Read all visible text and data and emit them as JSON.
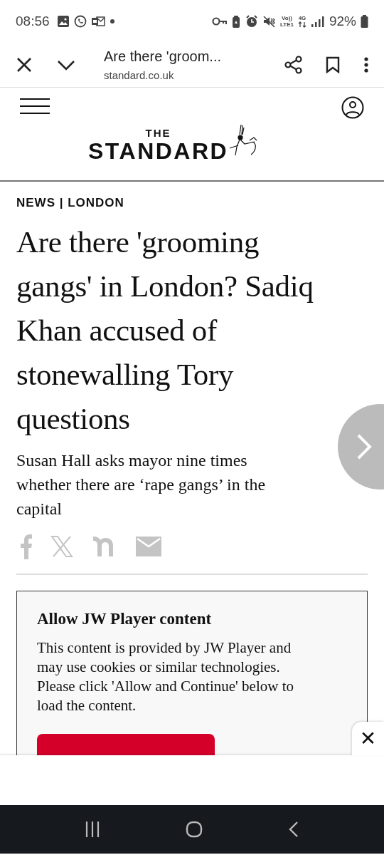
{
  "status_bar": {
    "time": "08:56",
    "volte_top": "Vo))",
    "volte_bottom": "LTE1",
    "network": "4G",
    "battery": "92%"
  },
  "browser_bar": {
    "title": "Are there 'groom...",
    "url": "standard.co.uk"
  },
  "site_header": {
    "logo_top": "THE",
    "logo_main": "STANDARD"
  },
  "article": {
    "kicker": "NEWS | LONDON",
    "headline_lines": [
      "Are there 'grooming",
      "gangs' in London? Sadiq",
      "Khan accused of",
      "stonewalling Tory",
      "questions"
    ],
    "standfirst_lines": [
      "Susan Hall asks mayor nine times",
      "whether there are ‘rape gangs’ in the",
      "capital"
    ],
    "share_icons": [
      {
        "kind": "facebook"
      },
      {
        "kind": "x"
      },
      {
        "kind": "nextdoor"
      },
      {
        "kind": "email"
      }
    ]
  },
  "embed": {
    "title": "Allow JW Player content",
    "body_lines": [
      "This content is provided by JW Player and",
      "may use cookies or similar technologies.",
      "Please click 'Allow and Continue' below to",
      "load the content."
    ]
  },
  "ad_close": "✕"
}
